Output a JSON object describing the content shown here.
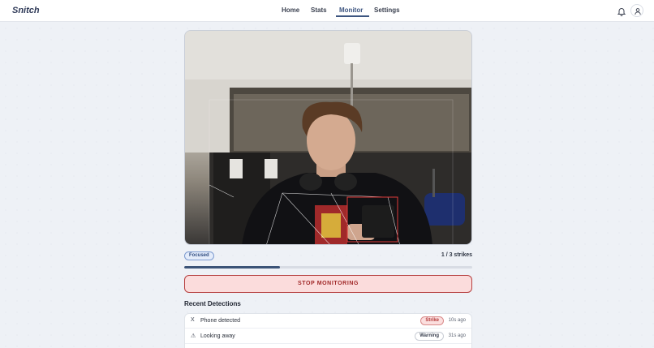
{
  "app": {
    "brand": "Snitch"
  },
  "nav": {
    "items": [
      {
        "label": "Home"
      },
      {
        "label": "Stats"
      },
      {
        "label": "Monitor",
        "active": true
      },
      {
        "label": "Settings"
      }
    ]
  },
  "header_icons": {
    "notifications": "bell-icon",
    "profile": "user-icon"
  },
  "monitor": {
    "status_badge": "Focused",
    "strikes_text": "1 / 3 strikes",
    "strikes_current": 1,
    "strikes_max": 3,
    "stop_button": "STOP MONITORING"
  },
  "detections": {
    "title": "Recent Detections",
    "items": [
      {
        "icon": "x-icon",
        "glyph": "X",
        "label": "Phone detected",
        "tag": "Strike",
        "time": "10s ago"
      },
      {
        "icon": "warning-icon",
        "glyph": "⚠",
        "label": "Looking away",
        "tag": "Warning",
        "time": "31s ago"
      }
    ]
  },
  "colors": {
    "accent": "#3d5580",
    "stop_bg": "#fbdcdc",
    "stop_border": "#b64040",
    "detection_box": "#e03a3a"
  }
}
